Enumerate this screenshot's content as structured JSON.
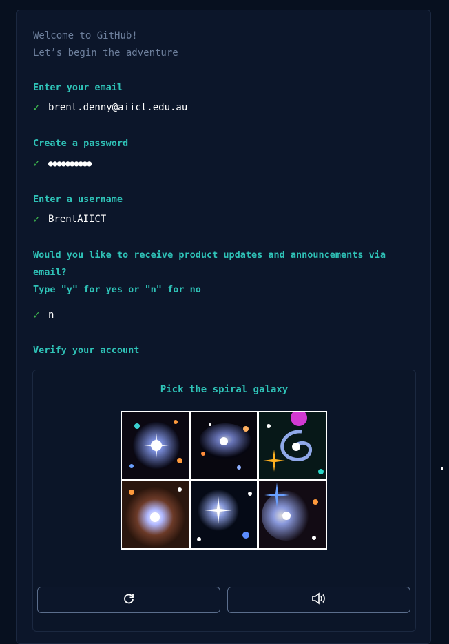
{
  "intro": {
    "line1": "Welcome to GitHub!",
    "line2": "Let’s begin the adventure"
  },
  "steps": {
    "email": {
      "label": "Enter your email",
      "check": "✓",
      "value": "brent.denny@aiict.edu.au"
    },
    "password": {
      "label": "Create a password",
      "check": "✓",
      "value": "●●●●●●●●●●"
    },
    "username": {
      "label": "Enter a username",
      "check": "✓",
      "value": "BrentAIICT"
    },
    "updates": {
      "question": "Would you like to receive product updates and announcements via email?",
      "hint": "Type \"y\" for yes or \"n\" for no",
      "check": "✓",
      "value": "n"
    },
    "verify": {
      "label": "Verify your account"
    }
  },
  "captcha": {
    "title": "Pick the spiral galaxy",
    "tiles": [
      {
        "icon": "galaxy-image-1"
      },
      {
        "icon": "galaxy-image-2"
      },
      {
        "icon": "spiral-galaxy-image"
      },
      {
        "icon": "galaxy-image-4"
      },
      {
        "icon": "galaxy-image-5"
      },
      {
        "icon": "galaxy-image-6"
      }
    ],
    "refresh_icon": "refresh-icon",
    "audio_icon": "speaker-icon"
  },
  "colors": {
    "accent": "#2fc2b7",
    "check": "#3fb950",
    "background": "#07101f",
    "card": "#0c162a"
  }
}
